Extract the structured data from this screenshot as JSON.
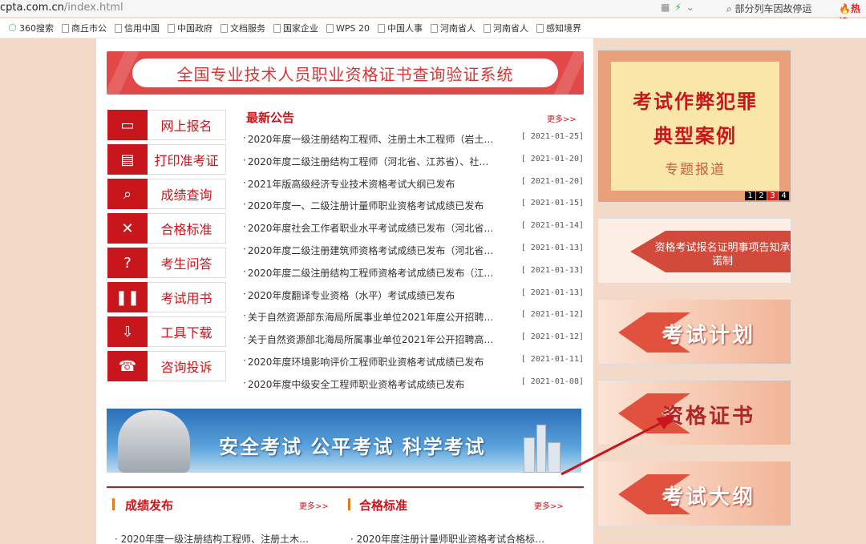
{
  "browser": {
    "url": "cpta.com.cn",
    "url_path": "/index.html",
    "search_text": "部分列车因故停运",
    "hot_label": "热搜",
    "bookmarks": [
      "360搜索",
      "商丘市公",
      "信用中国",
      "中国政府",
      "文档服务",
      "国家企业",
      "WPS 20",
      "中国人事",
      "河南省人",
      "河南省人",
      "感知境界"
    ]
  },
  "banner": {
    "title": "全国专业技术人员职业资格证书查询验证系统"
  },
  "menu": [
    {
      "label": "网上报名",
      "icon": "monitor-icon"
    },
    {
      "label": "打印准考证",
      "icon": "printer-icon"
    },
    {
      "label": "成绩查询",
      "icon": "search-doc-icon"
    },
    {
      "label": "合格标准",
      "icon": "tools-icon"
    },
    {
      "label": "考生问答",
      "icon": "question-icon"
    },
    {
      "label": "考试用书",
      "icon": "books-icon"
    },
    {
      "label": "工具下载",
      "icon": "download-icon"
    },
    {
      "label": "咨询投诉",
      "icon": "phone-icon"
    }
  ],
  "news": {
    "title": "最新公告",
    "more": "更多>>",
    "items": [
      {
        "t": "2020年度一级注册结构工程师、注册土木工程师（岩土…",
        "d": "[ 2021-01-25]"
      },
      {
        "t": "2020年度二级注册结构工程师（河北省、江苏省）、社…",
        "d": "[ 2021-01-20]"
      },
      {
        "t": "2021年版高级经济专业技术资格考试大纲已发布",
        "d": "[ 2021-01-20]"
      },
      {
        "t": "2020年度一、二级注册计量师职业资格考试成绩已发布",
        "d": "[ 2021-01-15]"
      },
      {
        "t": "2020年度社会工作者职业水平考试成绩已发布（河北省…",
        "d": "[ 2021-01-14]"
      },
      {
        "t": "2020年度二级注册建筑师资格考试成绩已发布（河北省…",
        "d": "[ 2021-01-13]"
      },
      {
        "t": "2020年度二级注册结构工程师资格考试成绩已发布（江…",
        "d": "[ 2021-01-13]"
      },
      {
        "t": "2020年度翻译专业资格（水平）考试成绩已发布",
        "d": "[ 2021-01-13]"
      },
      {
        "t": "关于自然资源部东海局所属事业单位2021年度公开招聘…",
        "d": "[ 2021-01-12]"
      },
      {
        "t": "关于自然资源部北海局所属事业单位2021年公开招聘高…",
        "d": "[ 2021-01-12]"
      },
      {
        "t": "2020年度环境影响评价工程师职业资格考试成绩已发布",
        "d": "[ 2021-01-11]"
      },
      {
        "t": "2020年度中级安全工程师职业资格考试成绩已发布",
        "d": "[ 2021-01-08]"
      }
    ]
  },
  "slogan": {
    "text": "安全考试  公平考试  科学考试"
  },
  "sections": [
    {
      "title": "成绩发布",
      "more": "更多>>",
      "first": "2020年度一级注册结构工程师、注册土木…"
    },
    {
      "title": "合格标准",
      "more": "更多>>",
      "first": "2020年度注册计量师职业资格考试合格标…"
    }
  ],
  "sidebar": {
    "feature": {
      "line1": "考试作弊犯罪",
      "line2": "典型案例",
      "line3": "专题报道",
      "pages": [
        "1",
        "2",
        "3",
        "4"
      ],
      "active_page": 3
    },
    "cert_notice": "资格考试报名证明事项告知承诺制",
    "exam_plan": "考试计划",
    "certificate": "资格证书",
    "syllabus": "考试大纲"
  }
}
